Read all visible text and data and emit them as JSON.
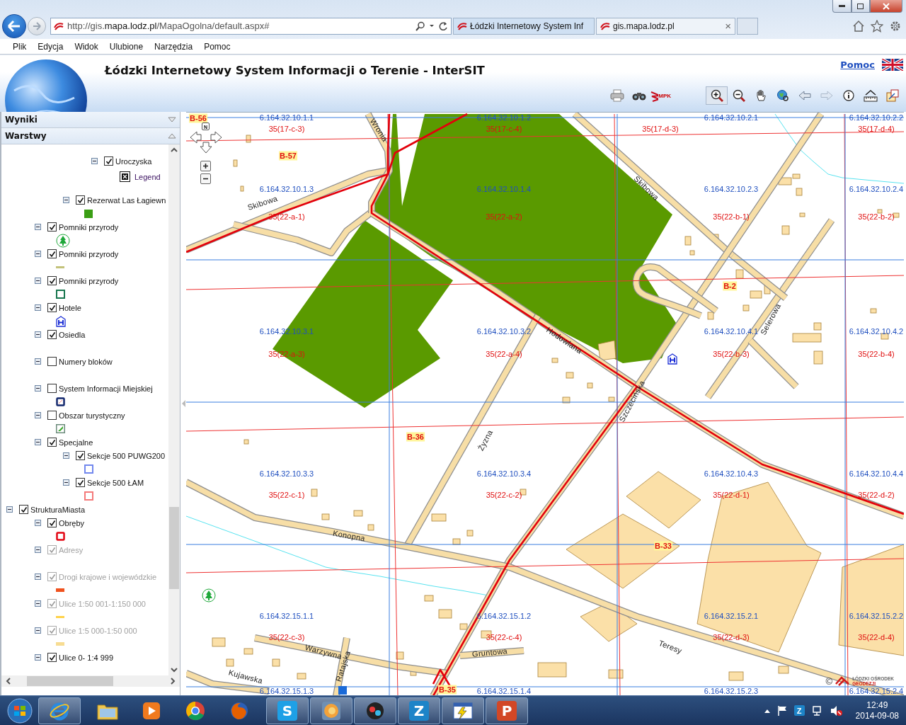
{
  "browser": {
    "address": "http://gis.**mapa.lodz.pl**/MapaOgolna/default.aspx#",
    "tabs": [
      {
        "title": "Łódzki Internetowy System Inf",
        "selected": true
      },
      {
        "title": "gis.mapa.lodz.pl",
        "selected": false,
        "close": "×"
      }
    ],
    "menu": [
      "Plik",
      "Edycja",
      "Widok",
      "Ulubione",
      "Narzędzia",
      "Pomoc"
    ]
  },
  "header": {
    "title": "Łódzki Internetowy System Informacji o Terenie - InterSIT",
    "help_link": "Pomoc",
    "tools": [
      {
        "kind": "printer",
        "selected": false,
        "disabled": false
      },
      {
        "kind": "binoculars",
        "selected": false,
        "disabled": false
      },
      {
        "kind": "logo",
        "label": "MPK",
        "selected": false,
        "disabled": false
      },
      {
        "kind": "zoom-in",
        "selected": true,
        "disabled": false
      },
      {
        "kind": "zoom-out",
        "selected": false,
        "disabled": false
      },
      {
        "kind": "pan",
        "selected": false,
        "disabled": false
      },
      {
        "kind": "globe",
        "selected": false,
        "disabled": false
      },
      {
        "kind": "back",
        "selected": false,
        "disabled": false
      },
      {
        "kind": "forward",
        "selected": false,
        "disabled": true
      },
      {
        "kind": "info",
        "selected": false,
        "disabled": false
      },
      {
        "kind": "measure",
        "selected": false,
        "disabled": false
      },
      {
        "kind": "resize",
        "selected": false,
        "disabled": false
      }
    ]
  },
  "sidebar": {
    "panels": [
      {
        "title": "Wyniki",
        "expanded": false
      },
      {
        "title": "Warstwy",
        "expanded": true
      }
    ],
    "layers": [
      {
        "kind": "group",
        "children": [
          {
            "kind": "group",
            "children": [
              {
                "kind": "group",
                "children": [
                  {
                    "kind": "layer",
                    "label": "Uroczyska",
                    "checked": true,
                    "disabled": false,
                    "expanded": true,
                    "children": [
                      {
                        "kind": "legend",
                        "label": "Legend"
                      }
                    ]
                  }
                ]
              },
              {
                "kind": "layer",
                "label": "Rezerwat Las Łagiewn",
                "checked": true,
                "disabled": false,
                "expanded": true,
                "legend": {
                  "kind": "fill",
                  "color": "#3a9e14"
                }
              }
            ]
          },
          {
            "kind": "layer",
            "label": "Pomniki przyrody",
            "checked": true,
            "disabled": false,
            "expanded": true,
            "legend": {
              "kind": "tree",
              "color": "#1fa83a"
            }
          },
          {
            "kind": "layer",
            "label": "Pomniki przyrody",
            "checked": true,
            "disabled": false,
            "expanded": true,
            "legend": {
              "kind": "line",
              "color": "#c3c27a"
            }
          },
          {
            "kind": "layer",
            "label": "Pomniki przyrody",
            "checked": true,
            "disabled": false,
            "expanded": true,
            "legend": {
              "kind": "outline",
              "color": "#17764e"
            }
          },
          {
            "kind": "layer",
            "label": "Hotele",
            "checked": true,
            "disabled": false,
            "expanded": true,
            "legend": {
              "kind": "hotel",
              "color": "#1c2fd6"
            }
          },
          {
            "kind": "layer",
            "label": "Osiedla",
            "checked": true,
            "disabled": false,
            "expanded": true,
            "legend": {
              "kind": "none"
            }
          },
          {
            "kind": "layer",
            "label": "Numery bloków",
            "checked": false,
            "disabled": false,
            "expanded": true,
            "legend": {
              "kind": "none"
            }
          },
          {
            "kind": "layer",
            "label": "System Informacji Miejskiej",
            "checked": false,
            "disabled": false,
            "expanded": true,
            "legend": {
              "kind": "framed-hatch",
              "color": "#14296e"
            }
          },
          {
            "kind": "layer",
            "label": "Obszar turystyczny",
            "checked": false,
            "disabled": false,
            "expanded": true,
            "legend": {
              "kind": "hatch",
              "color": "#6c8c7c"
            }
          },
          {
            "kind": "layer",
            "label": "Specjalne",
            "checked": true,
            "disabled": false,
            "expanded": true,
            "children": [
              {
                "kind": "layer",
                "label": "Sekcje 500 PUWG200",
                "checked": true,
                "disabled": false,
                "expanded": true,
                "legend": {
                  "kind": "outline",
                  "color": "#7288ee"
                }
              },
              {
                "kind": "layer",
                "label": "Sekcje 500 ŁAM",
                "checked": true,
                "disabled": false,
                "expanded": true,
                "legend": {
                  "kind": "outline",
                  "color": "#f47a7a"
                }
              }
            ]
          }
        ]
      },
      {
        "kind": "layer",
        "label": "StrukturaMiasta",
        "checked": true,
        "disabled": false,
        "expanded": true,
        "children": [
          {
            "kind": "layer",
            "label": "Obręby",
            "checked": true,
            "disabled": false,
            "expanded": true,
            "legend": {
              "kind": "thick-outline",
              "color": "#e30613"
            }
          },
          {
            "kind": "layer",
            "label": "Adresy",
            "checked": true,
            "disabled": true,
            "expanded": true,
            "legend": {
              "kind": "none"
            }
          },
          {
            "kind": "layer",
            "label": "Drogi krajowe i wojewódzkie",
            "checked": true,
            "disabled": true,
            "expanded": true,
            "legend": {
              "kind": "bar",
              "color": "#f0521e"
            }
          },
          {
            "kind": "layer",
            "label": "Ulice 1:50 001-1:150 000",
            "checked": true,
            "disabled": true,
            "expanded": true,
            "legend": {
              "kind": "line",
              "color": "#ffd24a"
            }
          },
          {
            "kind": "layer",
            "label": "Ulice 1:5 000-1:50 000",
            "checked": true,
            "disabled": true,
            "expanded": true,
            "legend": {
              "kind": "bar",
              "color": "#f7dc92"
            }
          },
          {
            "kind": "layer",
            "label": "Ulice 0- 1:4 999",
            "checked": true,
            "disabled": false,
            "expanded": true
          }
        ]
      }
    ]
  },
  "map": {
    "compass": "N",
    "sections": [
      {
        "number": "6.164.32.10.1.1",
        "sheet": "35(17-c-3)"
      },
      {
        "number": "6.164.32.10.1.2",
        "sheet": "35(17-c-4)"
      },
      {
        "number": "6.164.32.10.2.1",
        "sheet": "35(17-d-3)"
      },
      {
        "number": "6.164.32.10.2.2",
        "sheet": "35(17-d-4)"
      },
      {
        "number": "6.164.32.10.1.3",
        "sheet": "35(22-a-1)"
      },
      {
        "number": "6.164.32.10.1.4",
        "sheet": "35(22-a-2)"
      },
      {
        "number": "6.164.32.10.2.3",
        "sheet": "35(22-b-1)"
      },
      {
        "number": "6.164.32.10.2.4",
        "sheet": "35(22-b-2)"
      },
      {
        "number": "6.164.32.10.3.1",
        "sheet": "35(22-a-3)"
      },
      {
        "number": "6.164.32.10.3.2",
        "sheet": "35(22-a-4)"
      },
      {
        "number": "6.164.32.10.4.1",
        "sheet": "35(22-b-3)"
      },
      {
        "number": "6.164.32.10.4.2",
        "sheet": "35(22-b-4)"
      },
      {
        "number": "6.164.32.10.3.3",
        "sheet": "35(22-c-1)"
      },
      {
        "number": "6.164.32.10.3.4",
        "sheet": "35(22-c-2)"
      },
      {
        "number": "6.164.32.10.4.3",
        "sheet": "35(22-d-1)"
      },
      {
        "number": "6.164.32.10.4.4",
        "sheet": "35(22-d-2)"
      },
      {
        "number": "6.164.32.15.1.1",
        "sheet": "35(22-c-3)"
      },
      {
        "number": "6.164.32.15.1.2",
        "sheet": "35(22-c-4)"
      },
      {
        "number": "6.164.32.15.2.1",
        "sheet": "35(22-d-3)"
      },
      {
        "number": "6.164.32.15.2.2",
        "sheet": "35(22-d-4)"
      },
      {
        "number": "6.164.32.15.1.3"
      },
      {
        "number": "6.164.32.15.1.4"
      },
      {
        "number": "6.164.32.15.2.3"
      },
      {
        "number": "6.164.32.15.2.4"
      }
    ],
    "blocks": [
      "B-56",
      "B-57",
      "B-2",
      "B-36",
      "B-33",
      "B-35"
    ],
    "streets": [
      "Wronia",
      "Skibowa",
      "Skibowa",
      "Hodowlana",
      "Szczecińska",
      "Selerowa",
      "Żyzna",
      "Konopna",
      "Teresy",
      "Gruntowa",
      "Warzywna",
      "Ratajska",
      "Kujawska"
    ],
    "copyright": "©",
    "logo_lines": [
      "ŁÓDZKI OŚRODEK",
      "GEODEZJI"
    ]
  },
  "taskbar": {
    "apps": [
      {
        "kind": "ie",
        "selected": true
      },
      {
        "kind": "folder",
        "selected": false
      },
      {
        "kind": "player",
        "selected": false
      },
      {
        "kind": "chrome",
        "selected": false
      },
      {
        "kind": "firefox",
        "selected": false
      },
      {
        "kind": "letter",
        "glyph": "S",
        "color": "#1ea0e6",
        "selected": true
      },
      {
        "kind": "swirl",
        "selected": true
      },
      {
        "kind": "badge",
        "selected": true
      },
      {
        "kind": "letter",
        "glyph": "Z",
        "color": "#1d84c8",
        "selected": true
      },
      {
        "kind": "lightning",
        "selected": true
      },
      {
        "kind": "letter",
        "glyph": "P",
        "color": "#d24726",
        "selected": true
      }
    ],
    "tray_glyph": "Z",
    "time": "12:49",
    "date": "2014-09-08"
  }
}
